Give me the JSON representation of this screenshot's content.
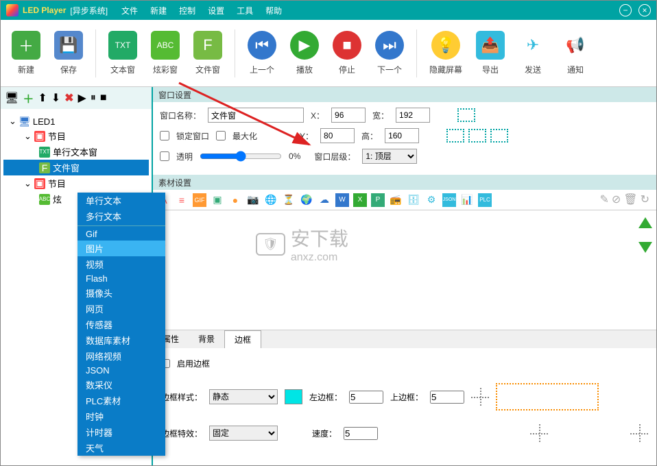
{
  "app": {
    "name": "LED Player",
    "subtitle": "[异步系统]"
  },
  "menu": [
    "文件",
    "新建",
    "控制",
    "设置",
    "工具",
    "帮助"
  ],
  "toolbar": [
    {
      "label": "新建",
      "color": "#4a4"
    },
    {
      "label": "保存",
      "color": "#58c"
    },
    {
      "label": "文本窗",
      "color": "#2a6"
    },
    {
      "label": "炫彩窗",
      "color": "#5b3"
    },
    {
      "label": "文件窗",
      "color": "#7b4"
    },
    {
      "label": "上一个",
      "color": "#37c"
    },
    {
      "label": "播放",
      "color": "#3a3"
    },
    {
      "label": "停止",
      "color": "#d33"
    },
    {
      "label": "下一个",
      "color": "#37c"
    },
    {
      "label": "隐藏屏幕",
      "color": "#fc3"
    },
    {
      "label": "导出",
      "color": "#3bd"
    },
    {
      "label": "发送",
      "color": "#3bd"
    },
    {
      "label": "通知",
      "color": "#9bd"
    }
  ],
  "tree": {
    "root": "LED1",
    "program1": "节目",
    "item_text": "单行文本窗",
    "item_file": "文件窗",
    "program2": "节目",
    "item_color": "炫"
  },
  "window_settings": {
    "header": "窗口设置",
    "name_label": "窗口名称：",
    "name_value": "文件窗",
    "x_label": "X：",
    "x": "96",
    "width_label": "宽：",
    "width": "192",
    "lock": "锁定窗口",
    "max": "最大化",
    "y_label": "Y：",
    "y": "80",
    "height_label": "高：",
    "height": "160",
    "trans_label": "透明",
    "trans_pct": "0%",
    "level_label": "窗口层级：",
    "level": "1: 顶层"
  },
  "material_header": "素材设置",
  "watermark": {
    "cn": "安下载",
    "en": "anxz.com"
  },
  "tabs": [
    "属性",
    "背景",
    "边框"
  ],
  "border": {
    "enable": "启用边框",
    "style_label": "边框样式：",
    "style_value": "静态",
    "left_label": "左边框：",
    "left": "5",
    "top_label": "上边框：",
    "top": "5",
    "effect_label": "边框特效：",
    "effect_value": "固定",
    "speed_label": "速度：",
    "speed": "5"
  },
  "context": {
    "group1": [
      "单行文本",
      "多行文本"
    ],
    "group2": [
      "Gif",
      "图片",
      "视频",
      "Flash",
      "摄像头",
      "网页",
      "传感器",
      "数据库素材",
      "网络视频",
      "JSON",
      "数采仪",
      "PLC素材",
      "时钟",
      "计时器",
      "天气"
    ]
  }
}
